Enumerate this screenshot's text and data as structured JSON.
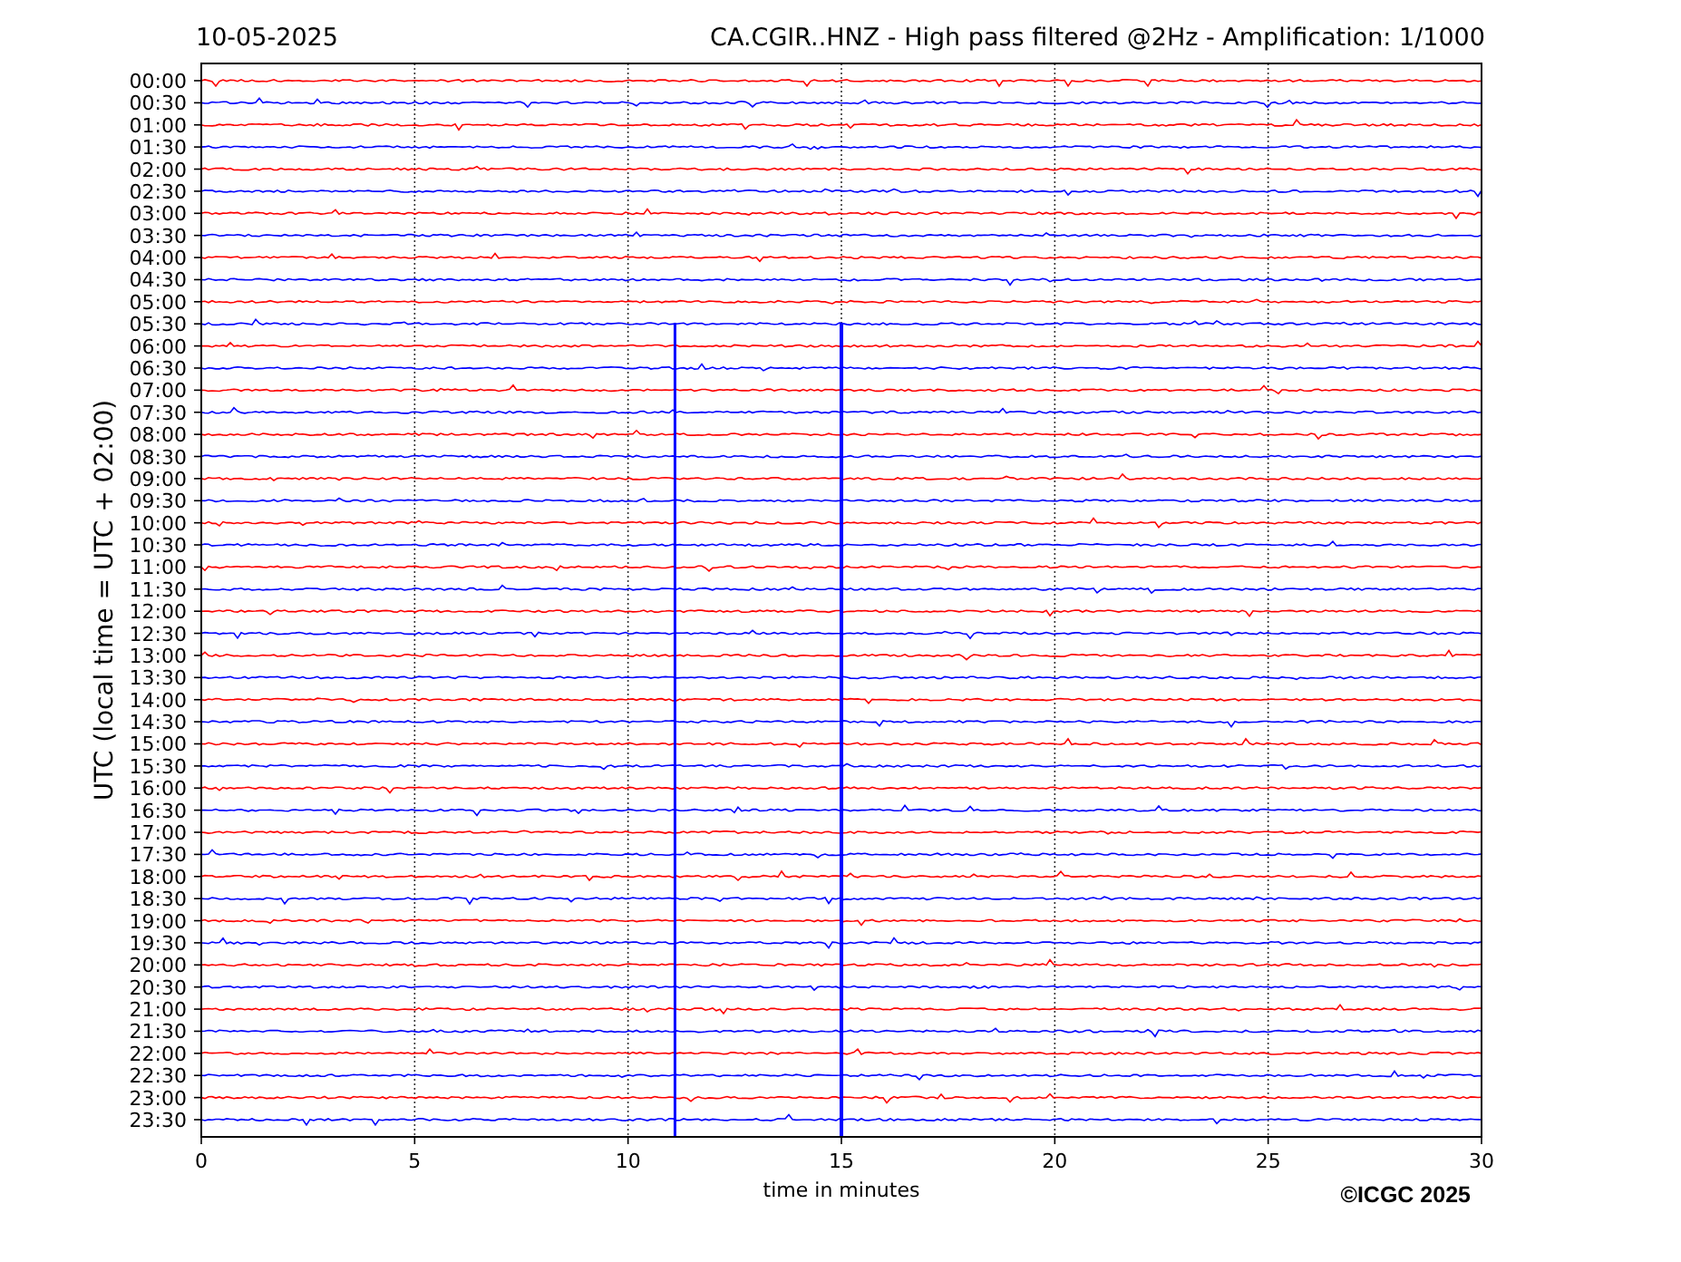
{
  "date": "10-05-2025",
  "title": "CA.CGIR..HNZ - High pass filtered @2Hz - Amplification: 1/1000",
  "y_axis": {
    "label": "UTC (local time = UTC + 02:00)"
  },
  "rows": [
    {
      "label": "00:00",
      "color": "#ff0000"
    },
    {
      "label": "00:30",
      "color": "#0000ff"
    },
    {
      "label": "01:00",
      "color": "#ff0000"
    },
    {
      "label": "01:30",
      "color": "#0000ff"
    },
    {
      "label": "02:00",
      "color": "#ff0000"
    },
    {
      "label": "02:30",
      "color": "#0000ff"
    },
    {
      "label": "03:00",
      "color": "#ff0000"
    },
    {
      "label": "03:30",
      "color": "#0000ff"
    },
    {
      "label": "04:00",
      "color": "#ff0000"
    },
    {
      "label": "04:30",
      "color": "#0000ff"
    },
    {
      "label": "05:00",
      "color": "#ff0000"
    },
    {
      "label": "05:30",
      "color": "#0000ff"
    },
    {
      "label": "06:00",
      "color": "#ff0000"
    },
    {
      "label": "06:30",
      "color": "#0000ff"
    },
    {
      "label": "07:00",
      "color": "#ff0000"
    },
    {
      "label": "07:30",
      "color": "#0000ff"
    },
    {
      "label": "08:00",
      "color": "#ff0000"
    },
    {
      "label": "08:30",
      "color": "#0000ff"
    },
    {
      "label": "09:00",
      "color": "#ff0000"
    },
    {
      "label": "09:30",
      "color": "#0000ff"
    },
    {
      "label": "10:00",
      "color": "#ff0000"
    },
    {
      "label": "10:30",
      "color": "#0000ff"
    },
    {
      "label": "11:00",
      "color": "#ff0000"
    },
    {
      "label": "11:30",
      "color": "#0000ff"
    },
    {
      "label": "12:00",
      "color": "#ff0000"
    },
    {
      "label": "12:30",
      "color": "#0000ff"
    },
    {
      "label": "13:00",
      "color": "#ff0000"
    },
    {
      "label": "13:30",
      "color": "#0000ff"
    },
    {
      "label": "14:00",
      "color": "#ff0000"
    },
    {
      "label": "14:30",
      "color": "#0000ff"
    },
    {
      "label": "15:00",
      "color": "#ff0000"
    },
    {
      "label": "15:30",
      "color": "#0000ff"
    },
    {
      "label": "16:00",
      "color": "#ff0000"
    },
    {
      "label": "16:30",
      "color": "#0000ff"
    },
    {
      "label": "17:00",
      "color": "#ff0000"
    },
    {
      "label": "17:30",
      "color": "#0000ff"
    },
    {
      "label": "18:00",
      "color": "#ff0000"
    },
    {
      "label": "18:30",
      "color": "#0000ff"
    },
    {
      "label": "19:00",
      "color": "#ff0000"
    },
    {
      "label": "19:30",
      "color": "#0000ff"
    },
    {
      "label": "20:00",
      "color": "#ff0000"
    },
    {
      "label": "20:30",
      "color": "#0000ff"
    },
    {
      "label": "21:00",
      "color": "#ff0000"
    },
    {
      "label": "21:30",
      "color": "#0000ff"
    },
    {
      "label": "22:00",
      "color": "#ff0000"
    },
    {
      "label": "22:30",
      "color": "#0000ff"
    },
    {
      "label": "23:00",
      "color": "#ff0000"
    },
    {
      "label": "23:30",
      "color": "#0000ff"
    }
  ],
  "x_axis": {
    "label": "time in minutes",
    "ticks": [
      "0",
      "5",
      "10",
      "15",
      "20",
      "25",
      "30"
    ]
  },
  "copyright": "©ICGC 2025"
}
